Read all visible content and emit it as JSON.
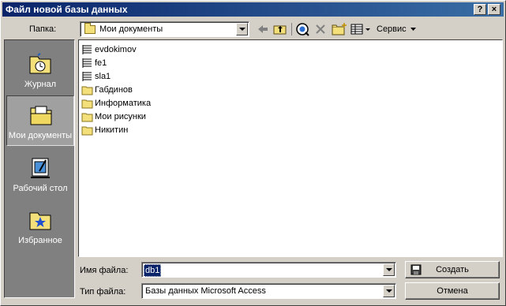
{
  "window": {
    "title": "Файл новой базы данных",
    "help_label": "?",
    "close_label": "×"
  },
  "location": {
    "label": "Папка:",
    "value": "Мои документы"
  },
  "toolbar": {
    "tools_label": "Сервис"
  },
  "places": [
    {
      "label": "Журнал",
      "icon": "history-icon",
      "selected": false
    },
    {
      "label": "Мои документы",
      "icon": "my-documents-icon",
      "selected": true
    },
    {
      "label": "Рабочий стол",
      "icon": "desktop-icon",
      "selected": false
    },
    {
      "label": "Избранное",
      "icon": "favorites-icon",
      "selected": false
    }
  ],
  "files": [
    {
      "name": "evdokimov",
      "type": "file"
    },
    {
      "name": "fe1",
      "type": "file"
    },
    {
      "name": "sla1",
      "type": "file"
    },
    {
      "name": "Габдинов",
      "type": "folder"
    },
    {
      "name": "Информатика",
      "type": "folder"
    },
    {
      "name": "Мои рисунки",
      "type": "folder"
    },
    {
      "name": "Никитин",
      "type": "folder"
    }
  ],
  "filename": {
    "label": "Имя файла:",
    "value": "db1"
  },
  "filetype": {
    "label": "Тип файла:",
    "value": "Базы данных Microsoft Access"
  },
  "buttons": {
    "create": "Создать",
    "cancel": "Отмена"
  },
  "colors": {
    "titlebar_start": "#0a246a",
    "titlebar_end": "#3a6ea5",
    "face": "#d4d0c8",
    "places_bg": "#808080",
    "selection": "#0a246a"
  }
}
